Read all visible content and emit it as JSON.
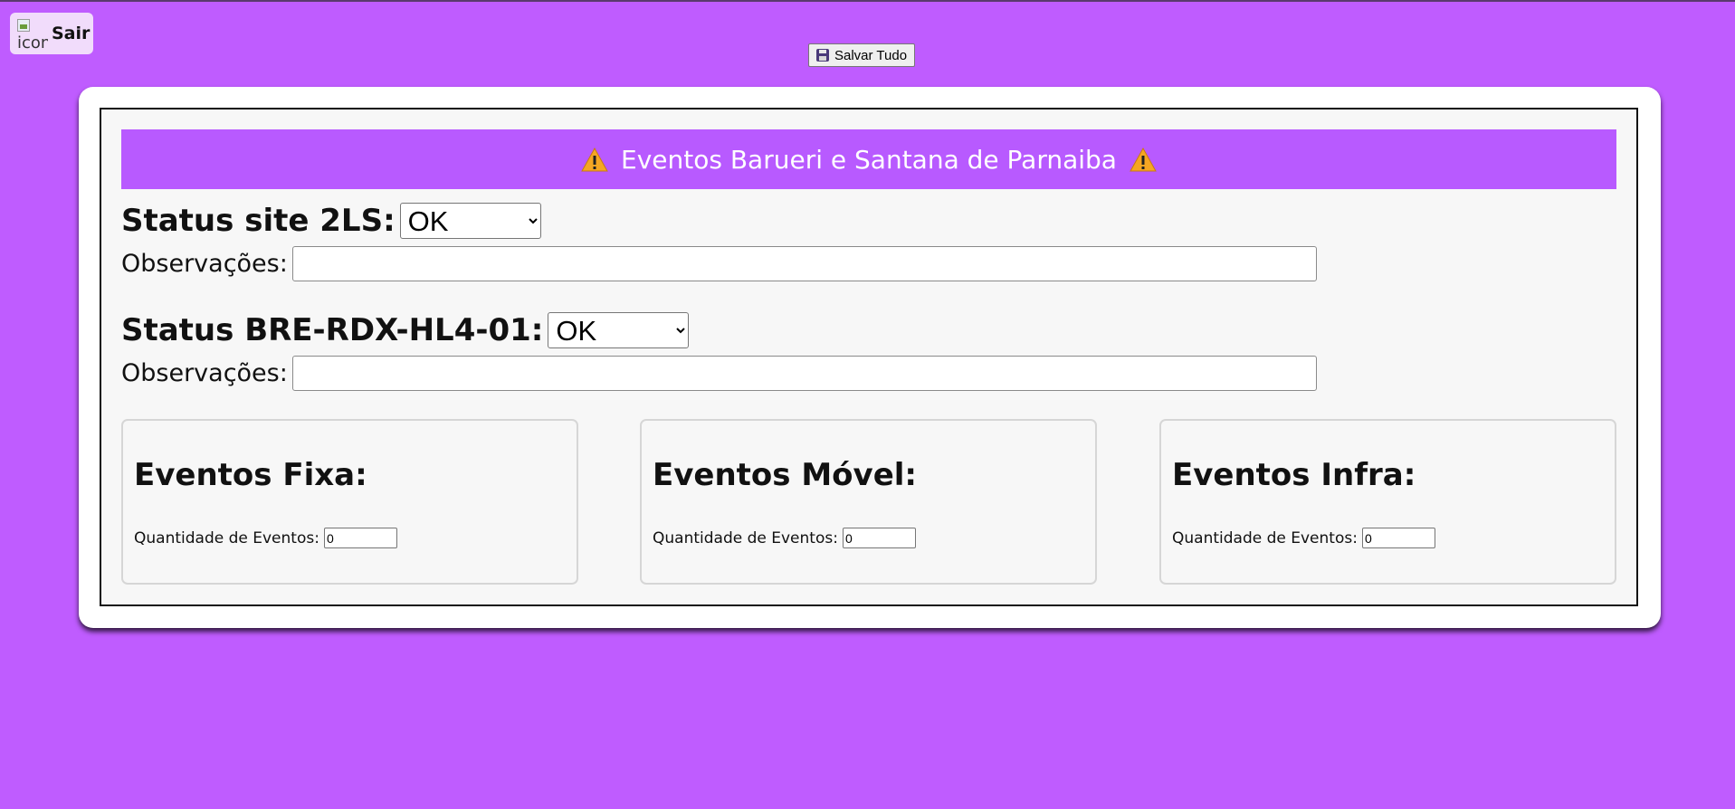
{
  "header": {
    "logout_label": "Sair",
    "logout_icon_alt": "icon",
    "save_all_label": "Salvar Tudo",
    "save_icon": "floppy-disk-icon"
  },
  "banner": {
    "title": "Eventos Barueri e Santana de Parnaiba",
    "icon": "warning-icon",
    "bg_color": "#b85aff"
  },
  "status_sections": [
    {
      "label": "Status site 2LS:",
      "selected": "OK",
      "obs_label": "Observações:",
      "obs_value": ""
    },
    {
      "label": "Status BRE-RDX-HL4-01:",
      "selected": "OK",
      "obs_label": "Observações:",
      "obs_value": ""
    }
  ],
  "events": [
    {
      "title": "Eventos Fixa:",
      "qty_label": "Quantidade de Eventos:",
      "qty_value": "0"
    },
    {
      "title": "Eventos Móvel:",
      "qty_label": "Quantidade de Eventos:",
      "qty_value": "0"
    },
    {
      "title": "Eventos Infra:",
      "qty_label": "Quantidade de Eventos:",
      "qty_value": "0"
    }
  ],
  "colors": {
    "page_bg": "#bf5cff",
    "card_bg": "#ffffff",
    "panel_bg": "#f7f7f7"
  }
}
